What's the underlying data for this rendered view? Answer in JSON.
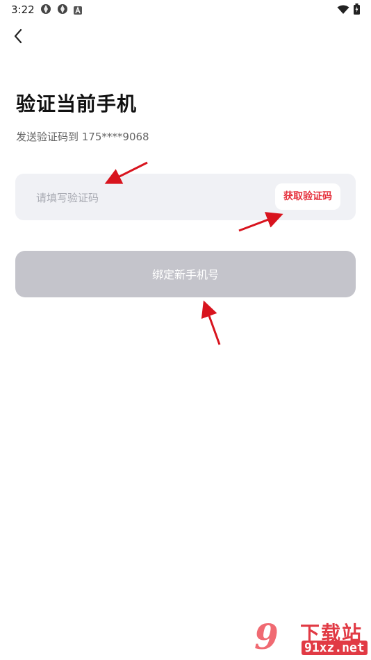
{
  "status_bar": {
    "time": "3:22",
    "left_icons": [
      "aperture-icon",
      "aperture-icon",
      "font-a-icon"
    ],
    "right_icons": [
      "wifi-icon",
      "battery-icon"
    ]
  },
  "header": {
    "back_icon": "chevron-left-icon"
  },
  "page": {
    "title": "验证当前手机",
    "subtitle": "发送验证码到 175****9068"
  },
  "verification": {
    "placeholder": "请填写验证码",
    "value": "",
    "get_code_label": "获取验证码"
  },
  "bind_button": {
    "label": "绑定新手机号"
  },
  "colors": {
    "accent": "#e5303c",
    "input_bg": "#f0f1f5",
    "button_disabled": "#c4c4cb",
    "annotation_arrow": "#d8141e"
  },
  "watermark": {
    "mark": "9",
    "title": "下载站",
    "url": "91xz.net"
  }
}
